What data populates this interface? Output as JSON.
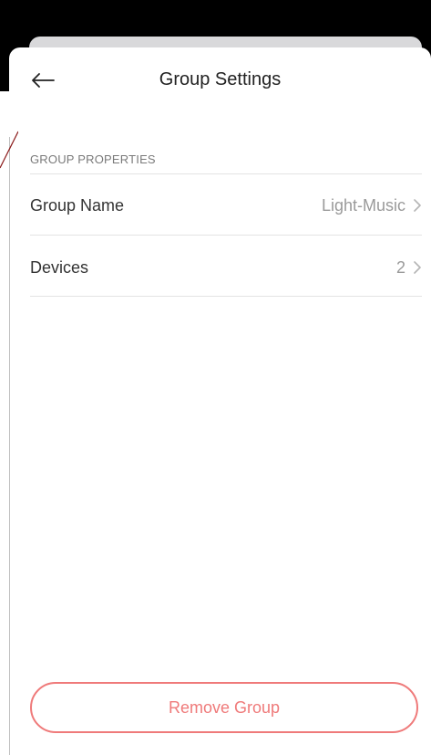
{
  "header": {
    "title": "Group Settings",
    "back_icon": "arrow-left-icon"
  },
  "section": {
    "title": "GROUP PROPERTIES"
  },
  "rows": [
    {
      "label": "Group Name",
      "value": "Light-Music",
      "icon": "chevron-right-icon"
    },
    {
      "label": "Devices",
      "value": "2",
      "icon": "chevron-right-icon"
    }
  ],
  "footer": {
    "remove_label": "Remove Group"
  },
  "colors": {
    "danger": "#ef7a7a",
    "text_primary": "#333333",
    "text_secondary": "#9a9a9a",
    "background": "#ffffff"
  }
}
